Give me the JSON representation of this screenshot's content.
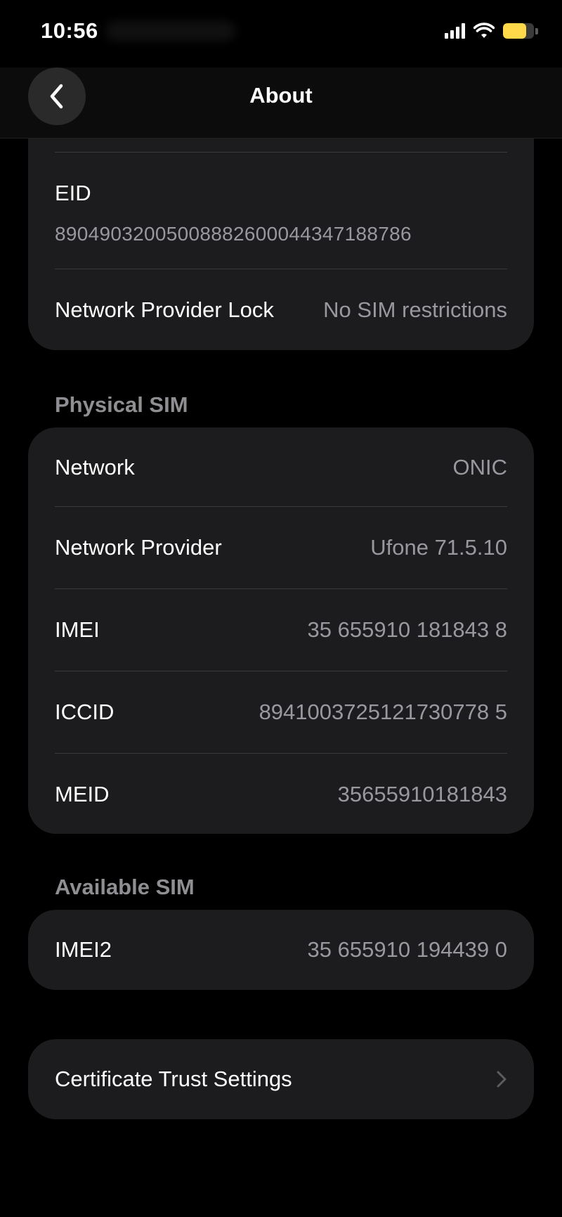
{
  "status_bar": {
    "time": "10:56",
    "battery_level_fraction": 0.75,
    "battery_color": "#FFD94A"
  },
  "nav": {
    "title": "About",
    "back_icon": "chevron-left-icon"
  },
  "top_group": {
    "eid_label": "EID",
    "eid_value": "89049032005008882600044347188786",
    "lock_label": "Network Provider Lock",
    "lock_value": "No SIM restrictions"
  },
  "physical_sim": {
    "header": "Physical SIM",
    "rows": [
      {
        "label": "Network",
        "value": "ONIC"
      },
      {
        "label": "Network Provider",
        "value": "Ufone 71.5.10"
      },
      {
        "label": "IMEI",
        "value": "35 655910 181843 8"
      },
      {
        "label": "ICCID",
        "value": "8941003725121730778 5"
      },
      {
        "label": "MEID",
        "value": "35655910181843"
      }
    ]
  },
  "available_sim": {
    "header": "Available SIM",
    "rows": [
      {
        "label": "IMEI2",
        "value": "35 655910 194439 0"
      }
    ]
  },
  "certificate": {
    "label": "Certificate Trust Settings",
    "chevron_icon": "chevron-right-icon"
  }
}
